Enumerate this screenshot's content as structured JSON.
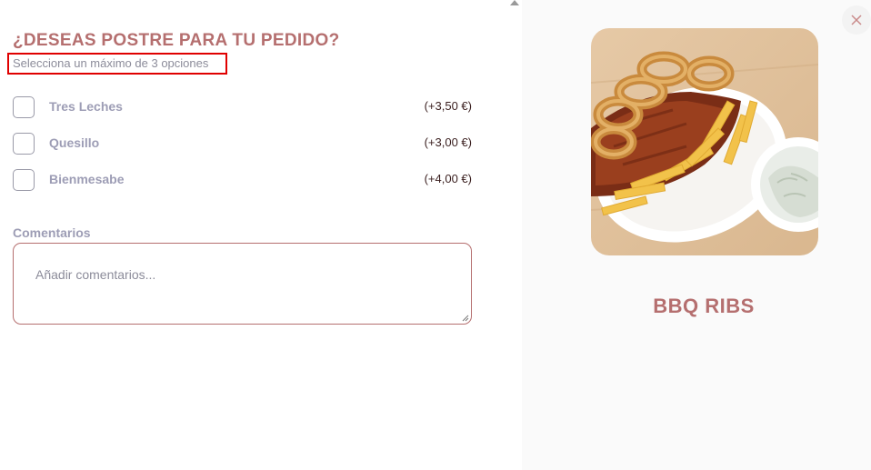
{
  "modal": {
    "title": "¿DESEAS POSTRE PARA TU PEDIDO?",
    "subtitle": "Selecciona un máximo de 3 opciones",
    "options": [
      {
        "label": "Tres Leches",
        "price": "(+3,50 €)"
      },
      {
        "label": "Quesillo",
        "price": "(+3,00 €)"
      },
      {
        "label": "Bienmesabe",
        "price": "(+4,00 €)"
      }
    ],
    "comments": {
      "label": "Comentarios",
      "placeholder": "Añadir comentarios..."
    }
  },
  "product": {
    "name": "BBQ RIBS",
    "image_icon": "bbq-ribs-plate-photo"
  },
  "close_icon": "close-icon",
  "colors": {
    "accent": "#b56f6f",
    "label": "#9d9db5",
    "highlight": "#e00000"
  }
}
